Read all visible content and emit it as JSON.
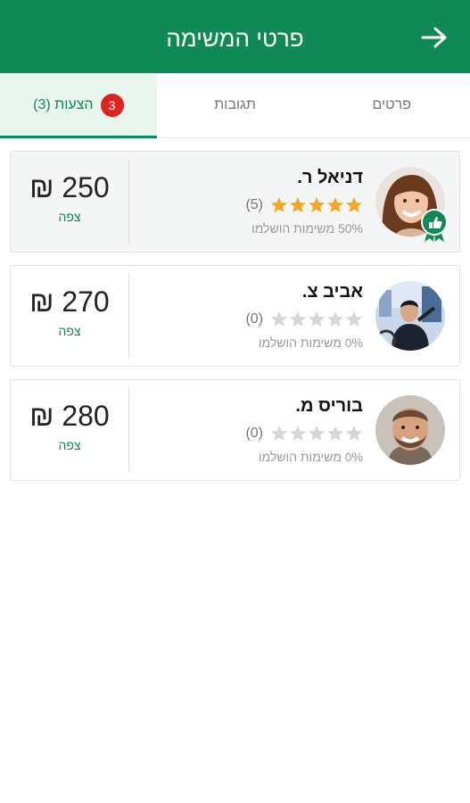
{
  "header": {
    "title": "פרטי המשימה",
    "back_icon": "arrow-right-icon"
  },
  "tabs": [
    {
      "label": "פרטים"
    },
    {
      "label": "תגובות"
    },
    {
      "label": "הצעות (3)",
      "badge": "3",
      "active": true
    }
  ],
  "offers": [
    {
      "name": "דניאל ר.",
      "rating": 5,
      "rating_count": "(5)",
      "completed": "50% משימות הושלמו",
      "price": "250 ₪",
      "view_label": "צפה",
      "verified": true,
      "avatar": "woman-avatar"
    },
    {
      "name": "אביב צ.",
      "rating": 0,
      "rating_count": "(0)",
      "completed": "0% משימות הושלמו",
      "price": "270 ₪",
      "view_label": "צפה",
      "verified": false,
      "avatar": "man-with-bicycle-avatar"
    },
    {
      "name": "בוריס מ.",
      "rating": 0,
      "rating_count": "(0)",
      "completed": "0% משימות הושלמו",
      "price": "280 ₪",
      "view_label": "צפה",
      "verified": false,
      "avatar": "smiling-man-avatar"
    }
  ],
  "colors": {
    "primary": "#0f8a56",
    "badge": "#e0231e",
    "star_filled": "#f5a623",
    "star_empty": "#d6d6d6"
  }
}
